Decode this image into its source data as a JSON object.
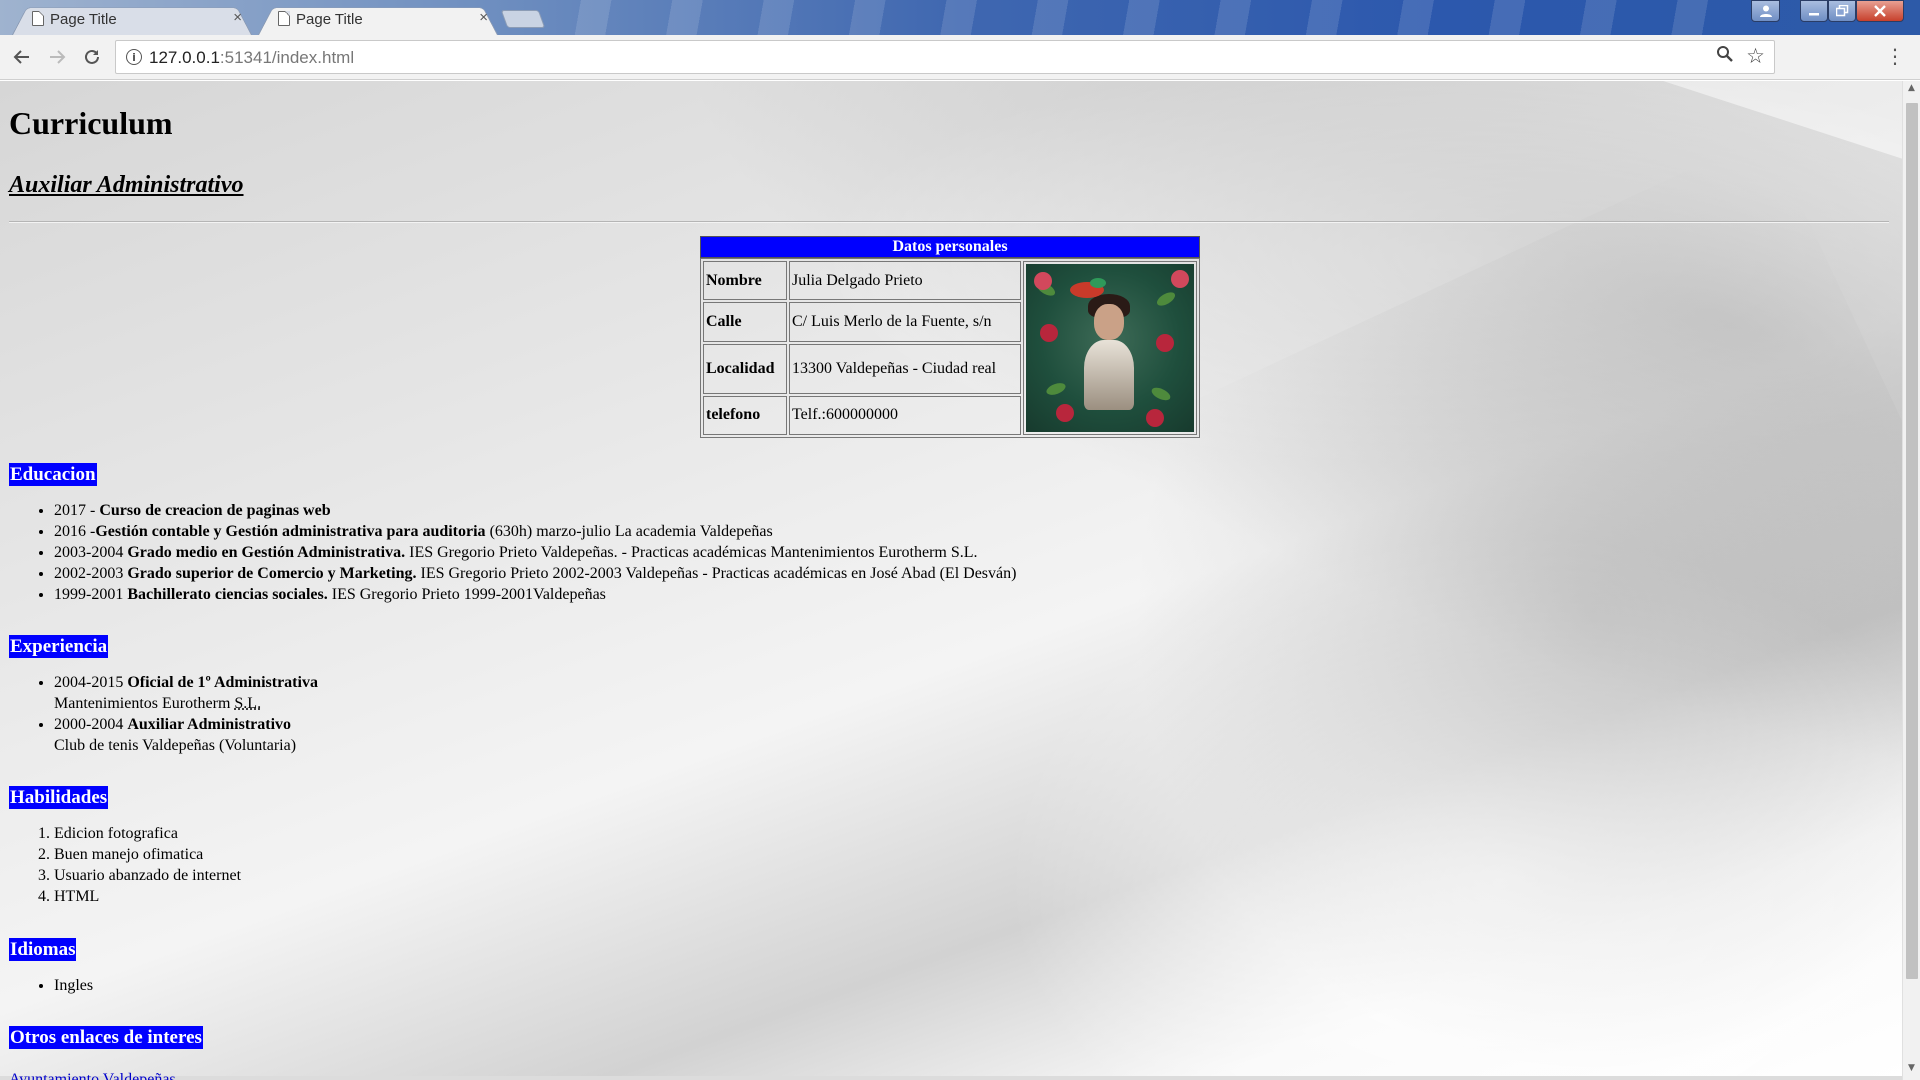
{
  "browser": {
    "tabs": [
      {
        "title": "Page Title",
        "active": false
      },
      {
        "title": "Page Title",
        "active": true
      }
    ],
    "close_glyph": "×",
    "url_host": "127.0.0.1",
    "url_rest": ":51341/index.html",
    "icons": {
      "back": "back-arrow-icon",
      "forward": "forward-arrow-icon",
      "reload": "reload-icon",
      "info": "info-icon",
      "zoom": "magnifier-icon",
      "bookmark": "star-icon",
      "menu": "kebab-menu-icon"
    }
  },
  "page": {
    "title": "Curriculum",
    "subtitle": "Auxiliar Administrativo",
    "personal": {
      "caption": "Datos personales",
      "rows": [
        {
          "label": "Nombre",
          "value": "Julia Delgado Prieto"
        },
        {
          "label": "Calle",
          "value": "C/ Luis Merlo de la Fuente, s/n"
        },
        {
          "label": "Localidad",
          "value": "13300 Valdepeñas - Ciudad real"
        },
        {
          "label": "telefono",
          "value": "Telf.:600000000"
        }
      ]
    },
    "education": {
      "heading": "Educacion",
      "items": [
        {
          "pre": "2017 - ",
          "bold": "Curso de creacion de paginas web",
          "post": ""
        },
        {
          "pre": "2016 -",
          "bold": "Gestión contable y Gestión administrativa para auditoria",
          "post": " (630h) marzo-julio La academia Valdepeñas"
        },
        {
          "pre": "2003-2004 ",
          "bold": "Grado medio en Gestión Administrativa.",
          "post": " IES Gregorio Prieto Valdepeñas. - Practicas académicas Mantenimientos Eurotherm S.L."
        },
        {
          "pre": "2002-2003 ",
          "bold": "Grado superior de Comercio y Marketing.",
          "post": " IES Gregorio Prieto 2002-2003 Valdepeñas - Practicas académicas en José Abad (El Desván)"
        },
        {
          "pre": "1999-2001 ",
          "bold": "Bachillerato ciencias sociales.",
          "post": " IES Gregorio Prieto 1999-2001Valdepeñas"
        }
      ]
    },
    "experience": {
      "heading": "Experiencia",
      "items": [
        {
          "pre": "2004-2015 ",
          "bold": "Oficial de 1º Administrativa",
          "line2_pre": "Mantenimientos Eurotherm ",
          "line2_abbr": "S.L."
        },
        {
          "pre": "2000-2004 ",
          "bold": "Auxiliar Administrativo",
          "line2_pre": "Club de tenis Valdepeñas (Voluntaria)",
          "line2_abbr": ""
        }
      ]
    },
    "skills": {
      "heading": "Habilidades",
      "items": [
        "Edicion fotografica",
        "Buen manejo ofimatica",
        "Usuario abanzado de internet",
        "HTML"
      ]
    },
    "languages": {
      "heading": "Idiomas",
      "items": [
        "Ingles"
      ]
    },
    "links": {
      "heading": "Otros enlaces de interes",
      "partial_link": "Ayuntamiento Valdepeñas"
    }
  },
  "colors": {
    "section_bg": "#0000ff",
    "section_fg": "#ffffff",
    "link": "#0000cc"
  }
}
